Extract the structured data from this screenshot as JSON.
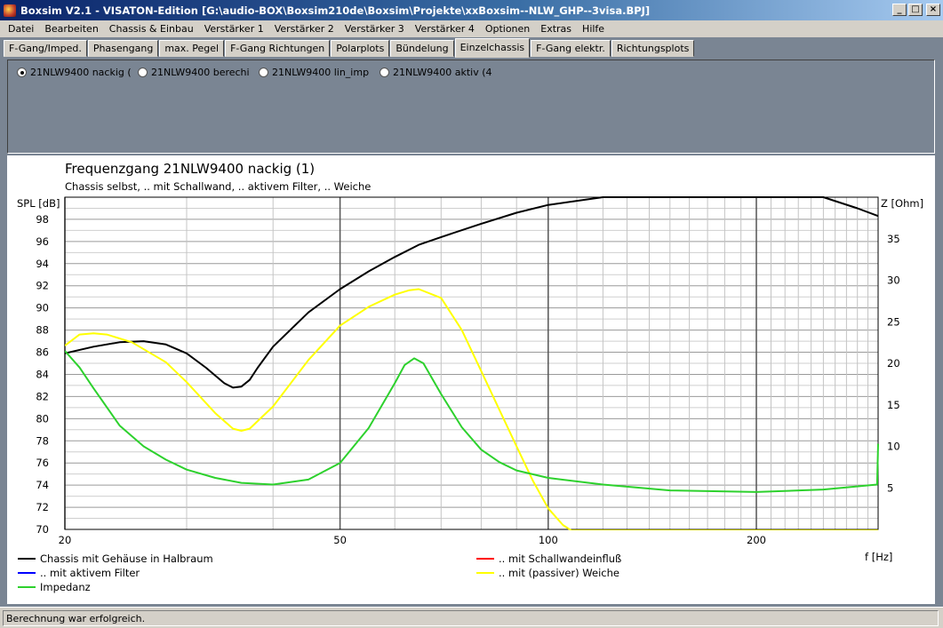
{
  "window": {
    "title": "Boxsim V2.1 - VISATON-Edition [G:\\audio-BOX\\Boxsim210de\\Boxsim\\Projekte\\xxBoxsim--NLW_GHP--3visa.BPJ]",
    "controls": [
      "_",
      "□",
      "×"
    ]
  },
  "menu": [
    "Datei",
    "Bearbeiten",
    "Chassis & Einbau",
    "Verstärker 1",
    "Verstärker 2",
    "Verstärker 3",
    "Verstärker 4",
    "Optionen",
    "Extras",
    "Hilfe"
  ],
  "tabs": [
    "F-Gang/Imped.",
    "Phasengang",
    "max. Pegel",
    "F-Gang Richtungen",
    "Polarplots",
    "Bündelung",
    "Einzelchassis",
    "F-Gang elektr.",
    "Richtungsplots"
  ],
  "active_tab": "Einzelchassis",
  "radio_options": [
    {
      "label": "21NLW9400 nackig (",
      "selected": true
    },
    {
      "label": "21NLW9400 berechi",
      "selected": false
    },
    {
      "label": "21NLW9400 lin_imp",
      "selected": false
    },
    {
      "label": "21NLW9400 aktiv (4",
      "selected": false
    }
  ],
  "status": "Berechnung war erfolgreich.",
  "chart_data": {
    "type": "line",
    "title": "Frequenzgang 21NLW9400 nackig (1)",
    "subtitle": "Chassis selbst, .. mit Schallwand, .. aktivem Filter, .. Weiche",
    "xlabel": "f [Hz]",
    "ylabel": "SPL [dB]",
    "y2label": "Z [Ohm]",
    "xscale": "log",
    "xlim": [
      20,
      300
    ],
    "ylim": [
      70,
      100
    ],
    "y2lim": [
      0,
      40
    ],
    "x_ticks": [
      20,
      50,
      100,
      200
    ],
    "y_ticks": [
      70,
      72,
      74,
      76,
      78,
      80,
      82,
      84,
      86,
      88,
      90,
      92,
      94,
      96,
      98
    ],
    "y2_ticks": [
      5,
      10,
      15,
      20,
      25,
      30,
      35
    ],
    "grid": true,
    "legend": [
      {
        "name": "Chassis mit Gehäuse in Halbraum",
        "color": "#000000"
      },
      {
        "name": ".. mit Schallwandeinfluß",
        "color": "#ff0000"
      },
      {
        "name": ".. mit aktivem Filter",
        "color": "#0000ff"
      },
      {
        "name": ".. mit (passiver) Weiche",
        "color": "#ffff00"
      },
      {
        "name": "Impedanz",
        "color": "#2dd12d"
      }
    ],
    "series": [
      {
        "name": "Chassis mit Gehäuse in Halbraum",
        "color": "#000000",
        "axis": "left",
        "x": [
          20,
          22,
          24,
          26,
          28,
          30,
          32,
          34,
          35,
          36,
          37,
          38,
          40,
          45,
          50,
          55,
          60,
          65,
          70,
          80,
          90,
          100,
          120,
          150,
          200,
          250,
          280,
          300
        ],
        "y": [
          85.9,
          86.5,
          86.9,
          87.0,
          86.7,
          85.9,
          84.6,
          83.2,
          82.8,
          82.9,
          83.5,
          84.6,
          86.5,
          89.6,
          91.7,
          93.3,
          94.6,
          95.7,
          96.4,
          97.6,
          98.6,
          99.3,
          100,
          100,
          100,
          100,
          99.0,
          98.3
        ]
      },
      {
        "name": ".. mit (passiver) Weiche",
        "color": "#ffff00",
        "axis": "left",
        "x": [
          20,
          21,
          22,
          23,
          25,
          28,
          30,
          33,
          35,
          36,
          37,
          40,
          45,
          50,
          55,
          60,
          63,
          65,
          70,
          75,
          80,
          85,
          90,
          95,
          100,
          105,
          108,
          150,
          200,
          300
        ],
        "y": [
          86.6,
          87.6,
          87.7,
          87.6,
          86.9,
          85.1,
          83.3,
          80.5,
          79.1,
          78.9,
          79.1,
          81.1,
          85.3,
          88.4,
          90.1,
          91.2,
          91.6,
          91.7,
          90.9,
          88.0,
          84.3,
          80.8,
          77.5,
          74.4,
          71.9,
          70.4,
          69.9,
          69.9,
          69.9,
          69.9
        ]
      },
      {
        "name": "Impedanz",
        "color": "#2dd12d",
        "axis": "right",
        "x": [
          20,
          21,
          22,
          24,
          26,
          28,
          30,
          33,
          36,
          40,
          45,
          50,
          55,
          60,
          62,
          64,
          66,
          70,
          75,
          80,
          85,
          90,
          100,
          120,
          150,
          200,
          250,
          299,
          300
        ],
        "y": [
          21.5,
          19.5,
          17.0,
          12.5,
          10.0,
          8.4,
          7.2,
          6.2,
          5.6,
          5.4,
          6.0,
          8.0,
          12.2,
          17.6,
          19.8,
          20.6,
          20.0,
          16.3,
          12.3,
          9.6,
          8.1,
          7.1,
          6.2,
          5.4,
          4.7,
          4.5,
          4.8,
          5.4,
          10.3
        ]
      }
    ]
  }
}
